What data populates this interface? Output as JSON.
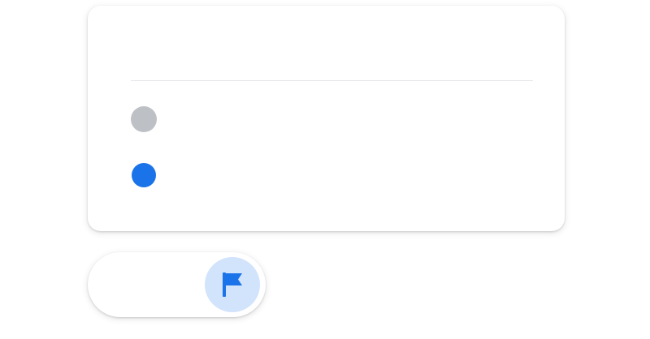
{
  "colors": {
    "accent": "#1a73e8",
    "neutral_dot": "#bdc1c6",
    "flag_button_bg": "#d2e3fc",
    "divider": "#e3e5e8"
  },
  "card": {
    "items": [
      {
        "marker": "gray-dot",
        "color": "#bdc1c6"
      },
      {
        "marker": "blue-dot",
        "color": "#1a73e8"
      }
    ]
  },
  "toggle_pill": {
    "active_icon": "flag-icon"
  }
}
